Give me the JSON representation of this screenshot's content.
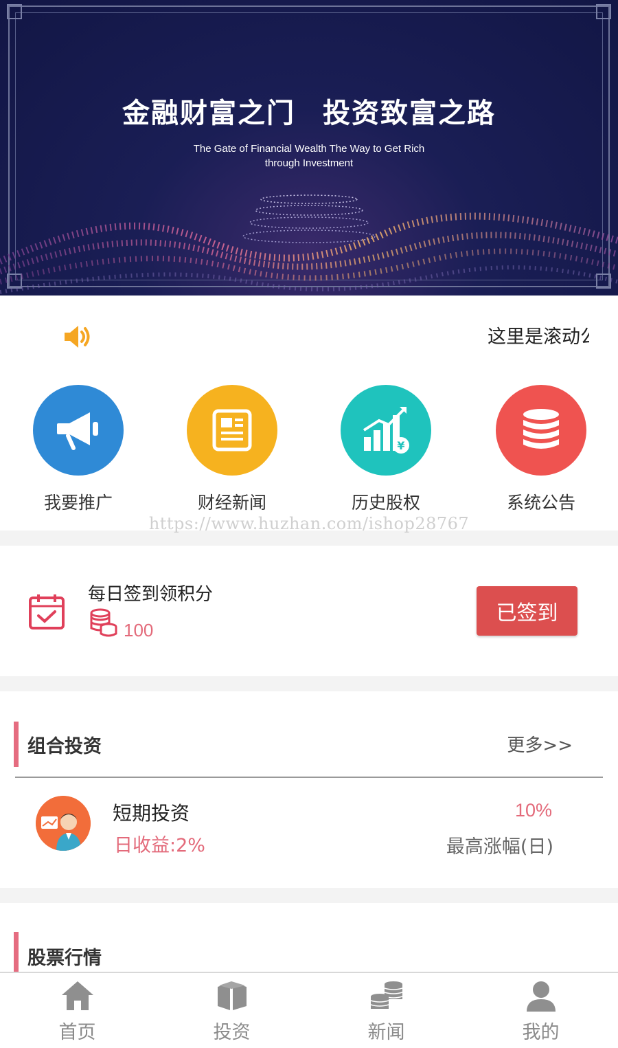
{
  "banner": {
    "title_left": "金融财富之门",
    "title_right": "投资致富之路",
    "subtitle_line1": "The Gate of Financial Wealth The Way to Get Rich",
    "subtitle_line2": "through Investment"
  },
  "marquee": {
    "icon": "speaker-icon",
    "text": "这里是滚动公告"
  },
  "grid": [
    {
      "label": "我要推广",
      "icon": "megaphone-icon",
      "color": "#2f8ad6"
    },
    {
      "label": "财经新闻",
      "icon": "news-icon",
      "color": "#f6b21f"
    },
    {
      "label": "历史股权",
      "icon": "chart-growth-icon",
      "color": "#1fc3bd"
    },
    {
      "label": "系统公告",
      "icon": "database-icon",
      "color": "#ef5350"
    }
  ],
  "watermark": "https://www.huzhan.com/ishop28767",
  "signin": {
    "title": "每日签到领积分",
    "points": "100",
    "button": "已签到",
    "accent": "#dc4f4f"
  },
  "portfolio": {
    "title": "组合投资",
    "more": "更多>>",
    "item": {
      "name": "短期投资",
      "daily_return": "日收益:2%",
      "max_rise": "10%",
      "max_rise_label": "最高涨幅(日)"
    }
  },
  "stocks": {
    "title": "股票行情"
  },
  "tabbar": [
    {
      "label": "首页",
      "icon": "home-icon"
    },
    {
      "label": "投资",
      "icon": "box-icon"
    },
    {
      "label": "新闻",
      "icon": "coins-icon"
    },
    {
      "label": "我的",
      "icon": "user-icon"
    }
  ]
}
